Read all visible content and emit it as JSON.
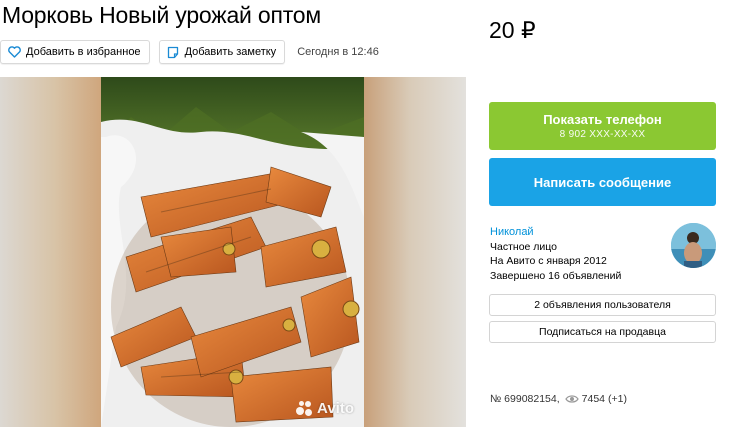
{
  "listing": {
    "title": "Морковь Новый урожай оптом",
    "price": "20 ₽"
  },
  "actions": {
    "favorite_label": "Добавить в избранное",
    "note_label": "Добавить заметку",
    "date": "Сегодня в 12:46"
  },
  "gallery": {
    "watermark": "Avito"
  },
  "contact": {
    "phone_button_label": "Показать телефон",
    "phone_masked": "8 902 XXX-XX-XX",
    "message_button_label": "Написать сообщение"
  },
  "seller": {
    "name": "Николай",
    "type": "Частное лицо",
    "since": "На Авито с января 2012",
    "completed": "Завершено 16 объявлений",
    "ads_button_label": "2 объявления пользователя",
    "subscribe_button_label": "Подписаться на продавца"
  },
  "meta": {
    "ad_number": "№ 699082154,",
    "views": "7454",
    "views_today": "(+1)"
  },
  "colors": {
    "phone_button": "#8bc832",
    "message_button": "#1aa3e6",
    "seller_link": "#0091d9"
  },
  "icons": {
    "favorite": "heart-icon",
    "note": "note-icon",
    "views": "eye-icon"
  }
}
